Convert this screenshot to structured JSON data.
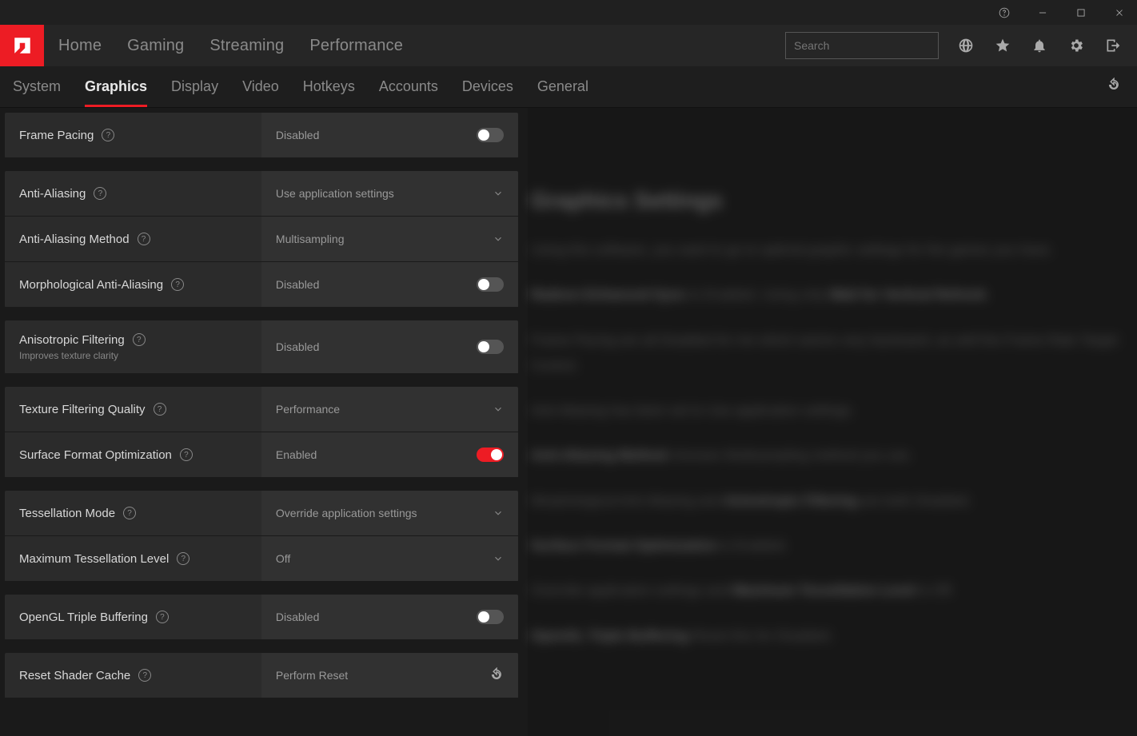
{
  "titlebar": {
    "help": "help-icon",
    "min": "minimize-icon",
    "max": "maximize-icon",
    "close": "close-icon"
  },
  "top_nav": {
    "items": [
      "Home",
      "Gaming",
      "Streaming",
      "Performance"
    ]
  },
  "search": {
    "placeholder": "Search"
  },
  "top_icons": [
    "globe-icon",
    "star-icon",
    "bell-icon",
    "gear-icon",
    "exit-icon"
  ],
  "top_icon_active": 3,
  "sub_nav": {
    "items": [
      "System",
      "Graphics",
      "Display",
      "Video",
      "Hotkeys",
      "Accounts",
      "Devices",
      "General"
    ],
    "active": 1
  },
  "settings": [
    {
      "group": 0,
      "label": "Frame Pacing",
      "type": "toggle",
      "value": "Disabled",
      "on": false
    },
    {
      "group": 1,
      "label": "Anti-Aliasing",
      "type": "select",
      "value": "Use application settings"
    },
    {
      "group": 1,
      "label": "Anti-Aliasing Method",
      "type": "select",
      "value": "Multisampling"
    },
    {
      "group": 1,
      "label": "Morphological Anti-Aliasing",
      "type": "toggle",
      "value": "Disabled",
      "on": false
    },
    {
      "group": 2,
      "label": "Anisotropic Filtering",
      "sub": "Improves texture clarity",
      "type": "toggle",
      "value": "Disabled",
      "on": false,
      "tall": true
    },
    {
      "group": 3,
      "label": "Texture Filtering Quality",
      "type": "select",
      "value": "Performance"
    },
    {
      "group": 3,
      "label": "Surface Format Optimization",
      "type": "toggle",
      "value": "Enabled",
      "on": true
    },
    {
      "group": 4,
      "label": "Tessellation Mode",
      "type": "select",
      "value": "Override application settings"
    },
    {
      "group": 4,
      "label": "Maximum Tessellation Level",
      "type": "select",
      "value": "Off"
    },
    {
      "group": 5,
      "label": "OpenGL Triple Buffering",
      "type": "toggle",
      "value": "Disabled",
      "on": false
    },
    {
      "group": 6,
      "label": "Reset Shader Cache",
      "type": "action",
      "value": "Perform Reset"
    }
  ],
  "right": {
    "heading": "Graphics Settings",
    "para1_a": "Using this software, you want to go to optimal graphic settings for the games you have.",
    "para1_b": "Radeon Enhanced Sync",
    "para1_c": " to Enabled. Using only ",
    "para1_d": "Wait for Vertical Refresh",
    "para1_e": ".",
    "para2": "Frame Pacing are all Disabled for me which seems very backward, as well the Frame Rate Target Control.",
    "para3a": "Anti-Aliasing has been set to Use application settings.",
    "para3b_a": "",
    "para3b_b": "Anti-Aliasing Method",
    "para3b_c": " chooses Multisampling method you use.",
    "para4_a": "Morphological Anti-Aliasing and ",
    "para4_b": "Anisotropic Filtering",
    "para4_c": " are both Disabled.",
    "para5_a": "",
    "para5_b": "Surface Format Optimization",
    "para5_c": " is Enabled.",
    "para6_a": "Override application settings and ",
    "para6_b": "Maximum Tessellation Level",
    "para6_c": " is Off.",
    "para7_a": "",
    "para7_b": "OpenGL Triple Buffering",
    "para7_c": " Reset this for Disabled."
  }
}
